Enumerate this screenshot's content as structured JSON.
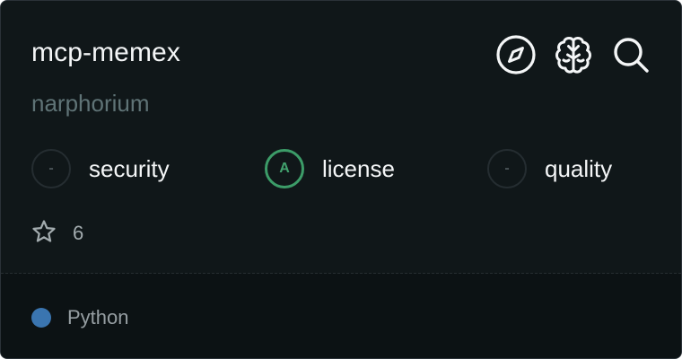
{
  "repo": {
    "name": "mcp-memex",
    "owner": "narphorium"
  },
  "actions": [
    {
      "icon": "compass-icon"
    },
    {
      "icon": "brain-icon"
    },
    {
      "icon": "search-icon"
    }
  ],
  "scores": {
    "security": {
      "label": "security",
      "grade": "-"
    },
    "license": {
      "label": "license",
      "grade": "A"
    },
    "quality": {
      "label": "quality",
      "grade": "-"
    }
  },
  "stars": {
    "icon": "star-icon",
    "count": "6"
  },
  "language": {
    "name": "Python",
    "color": "#3a75b0"
  },
  "colors": {
    "card_background": "#101719",
    "footer_background": "#0c1214",
    "grade_good": "#3c9c68",
    "owner_text": "#5f7376"
  }
}
